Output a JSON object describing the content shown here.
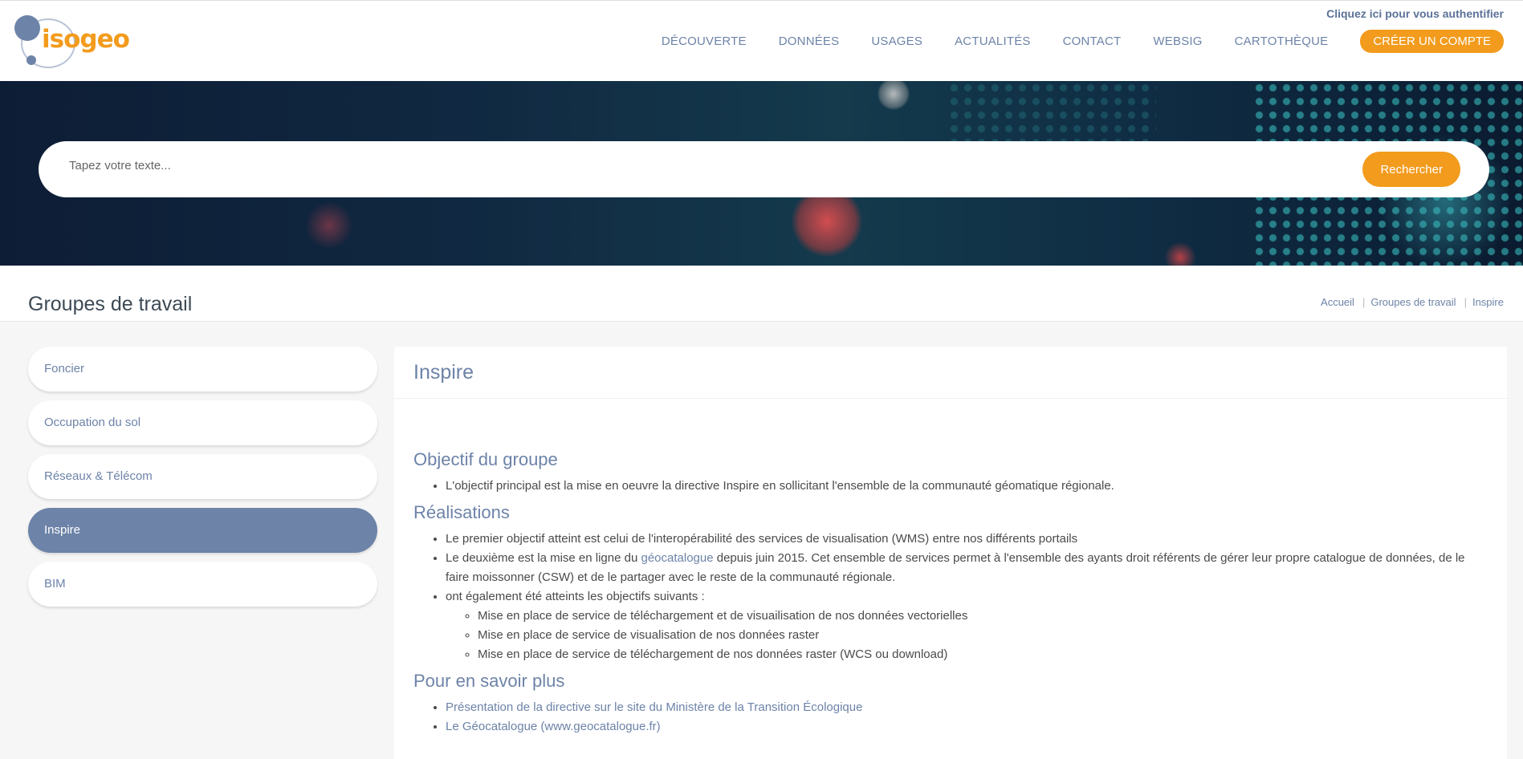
{
  "header": {
    "logo_text": "isogeo",
    "auth_link": "Cliquez ici pour vous authentifier",
    "nav": [
      "DÉCOUVERTE",
      "DONNÉES",
      "USAGES",
      "ACTUALITÉS",
      "CONTACT",
      "WEBSIG",
      "CARTOTHÈQUE"
    ],
    "cta": "CRÉER UN COMPTE"
  },
  "search": {
    "placeholder": "Tapez votre texte...",
    "button": "Rechercher"
  },
  "page": {
    "title": "Groupes de travail",
    "breadcrumb": [
      "Accueil",
      "Groupes de travail",
      "Inspire"
    ]
  },
  "sidebar": {
    "items": [
      "Foncier",
      "Occupation du sol",
      "Réseaux & Télécom",
      "Inspire",
      "BIM"
    ],
    "active_index": 3
  },
  "content": {
    "title": "Inspire",
    "objectif": {
      "heading": "Objectif du groupe",
      "items": [
        "L'objectif principal est la mise en oeuvre la directive Inspire en sollicitant l'ensemble de la communauté géomatique régionale."
      ]
    },
    "realisations": {
      "heading": "Réalisations",
      "item1": "Le premier objectif atteint est celui de l'interopérabilité des services de visualisation (WMS) entre nos différents portails",
      "item2_pre": "Le deuxième est la mise en ligne du ",
      "item2_link": "géocatalogue",
      "item2_post": " depuis juin 2015. Cet ensemble de services permet à l'ensemble des ayants droit référents de gérer leur propre catalogue de données, de le faire moissonner (CSW) et de le partager avec le reste de la communauté régionale.",
      "item3": "ont également été atteints les objectifs suivants :",
      "subitems": [
        "Mise en place de service de téléchargement et de visuailisation de nos données vectorielles",
        "Mise en place de service de visualisation de nos données raster",
        "Mise en place de service de téléchargement de nos données raster (WCS ou download)"
      ]
    },
    "savoir_plus": {
      "heading": "Pour en savoir plus",
      "links": [
        "Présentation de la directive sur le site du Ministère de la Transition Écologique",
        "Le Géocatalogue (www.geocatalogue.fr)"
      ]
    }
  },
  "colors": {
    "accent": "#f29b1d",
    "primary": "#6d83a8",
    "hero_bg": "#102841"
  },
  "icons": [
    "isogeo-logo"
  ]
}
